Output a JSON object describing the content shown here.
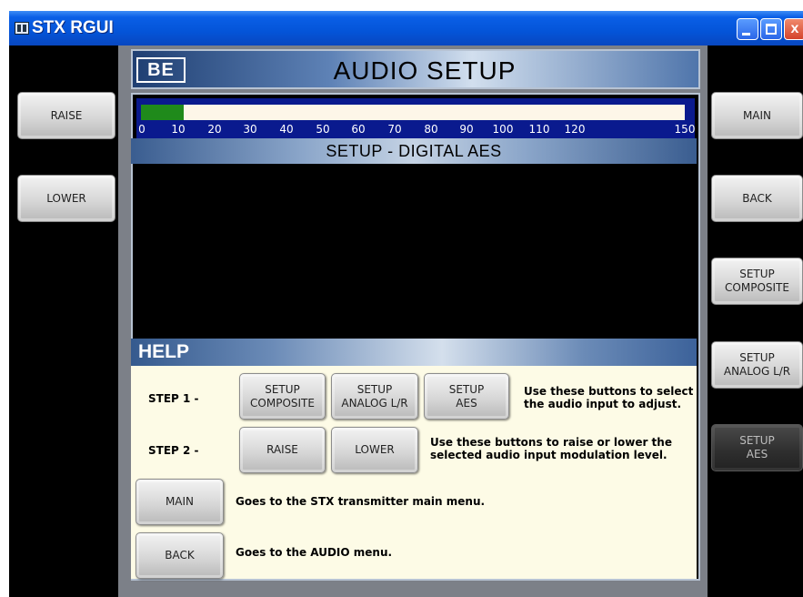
{
  "window": {
    "title": "STX RGUI",
    "minimize": "",
    "maximize": "",
    "close": "x"
  },
  "header": {
    "logo": "BE",
    "title": "AUDIO SETUP"
  },
  "meter": {
    "level_fraction": 0.078,
    "ticks": [
      "0",
      "10",
      "20",
      "30",
      "40",
      "50",
      "60",
      "70",
      "80",
      "90",
      "100",
      "110",
      "120",
      "150"
    ],
    "fill_color": "#1f8a1b",
    "background_color": "#0a1a8e"
  },
  "subtitle": "SETUP - DIGITAL AES",
  "left_buttons": {
    "raise": "RAISE",
    "lower": "LOWER"
  },
  "right_buttons": {
    "main": "MAIN",
    "back": "BACK",
    "setup_composite": "SETUP\nCOMPOSITE",
    "setup_analog": "SETUP\nANALOG L/R",
    "setup_aes": "SETUP\nAES"
  },
  "help": {
    "title": "HELP",
    "step1_label": "STEP 1 -",
    "step1_buttons": {
      "composite": "SETUP\nCOMPOSITE",
      "analog": "SETUP\nANALOG L/R",
      "aes": "SETUP\nAES"
    },
    "step1_text": "Use these buttons to select\nthe audio input to adjust.",
    "step2_label": "STEP 2 -",
    "step2_buttons": {
      "raise": "RAISE",
      "lower": "LOWER"
    },
    "step2_text": "Use these buttons to raise or lower the\nselected audio input modulation level.",
    "main_button": "MAIN",
    "main_text": "Goes to the STX transmitter main menu.",
    "back_button": "BACK",
    "back_text": "Goes to the AUDIO menu."
  }
}
